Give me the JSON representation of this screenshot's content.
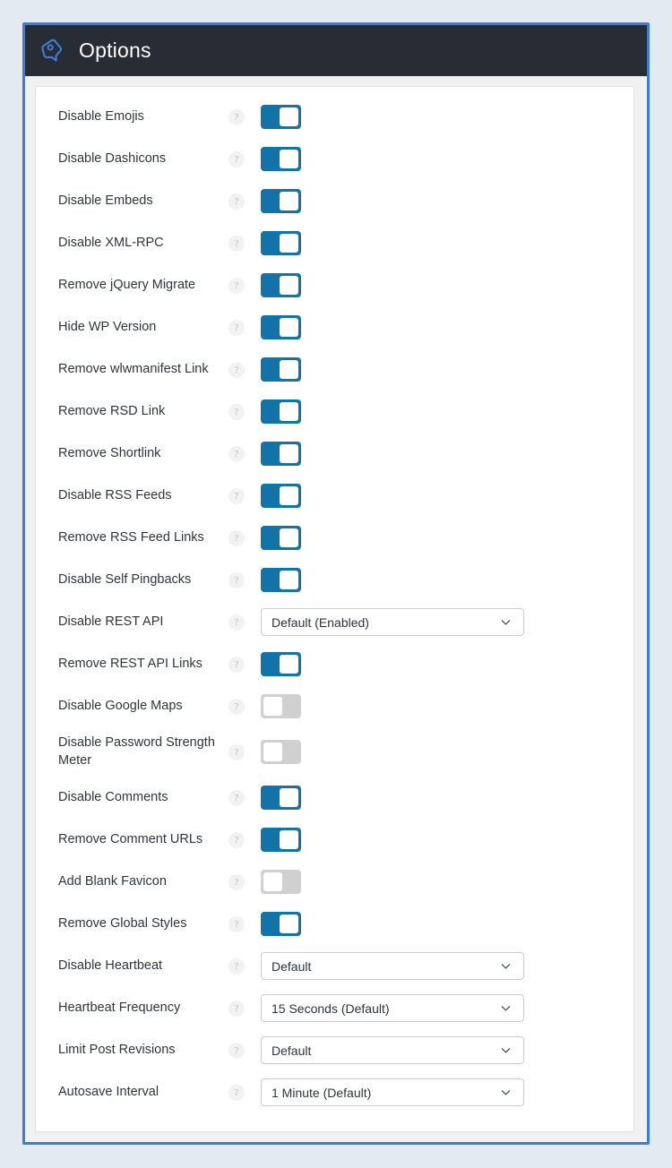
{
  "header": {
    "title": "Options",
    "logo_icon": "perfmatters-tag-icon",
    "background_color": "#282c34",
    "border_color": "#3a7fd5"
  },
  "colors": {
    "page_background": "#e4eaf2",
    "toggle_on": "#1273a8",
    "toggle_off": "#d0d0d0",
    "card_background": "#ffffff"
  },
  "help_glyph": "?",
  "chevron_icon": "chevron-down-icon",
  "options": [
    {
      "label": "Disable Emojis",
      "control": "toggle",
      "state": "on"
    },
    {
      "label": "Disable Dashicons",
      "control": "toggle",
      "state": "on"
    },
    {
      "label": "Disable Embeds",
      "control": "toggle",
      "state": "on"
    },
    {
      "label": "Disable XML-RPC",
      "control": "toggle",
      "state": "on"
    },
    {
      "label": "Remove jQuery Migrate",
      "control": "toggle",
      "state": "on"
    },
    {
      "label": "Hide WP Version",
      "control": "toggle",
      "state": "on"
    },
    {
      "label": "Remove wlwmanifest Link",
      "control": "toggle",
      "state": "on"
    },
    {
      "label": "Remove RSD Link",
      "control": "toggle",
      "state": "on"
    },
    {
      "label": "Remove Shortlink",
      "control": "toggle",
      "state": "on"
    },
    {
      "label": "Disable RSS Feeds",
      "control": "toggle",
      "state": "on"
    },
    {
      "label": "Remove RSS Feed Links",
      "control": "toggle",
      "state": "on"
    },
    {
      "label": "Disable Self Pingbacks",
      "control": "toggle",
      "state": "on"
    },
    {
      "label": "Disable REST API",
      "control": "select",
      "value": "Default (Enabled)"
    },
    {
      "label": "Remove REST API Links",
      "control": "toggle",
      "state": "on"
    },
    {
      "label": "Disable Google Maps",
      "control": "toggle",
      "state": "off"
    },
    {
      "label": "Disable Password Strength Meter",
      "control": "toggle",
      "state": "off"
    },
    {
      "label": "Disable Comments",
      "control": "toggle",
      "state": "on"
    },
    {
      "label": "Remove Comment URLs",
      "control": "toggle",
      "state": "on"
    },
    {
      "label": "Add Blank Favicon",
      "control": "toggle",
      "state": "off"
    },
    {
      "label": "Remove Global Styles",
      "control": "toggle",
      "state": "on"
    },
    {
      "label": "Disable Heartbeat",
      "control": "select",
      "value": "Default"
    },
    {
      "label": "Heartbeat Frequency",
      "control": "select",
      "value": "15 Seconds (Default)"
    },
    {
      "label": "Limit Post Revisions",
      "control": "select",
      "value": "Default"
    },
    {
      "label": "Autosave Interval",
      "control": "select",
      "value": "1 Minute (Default)"
    }
  ]
}
